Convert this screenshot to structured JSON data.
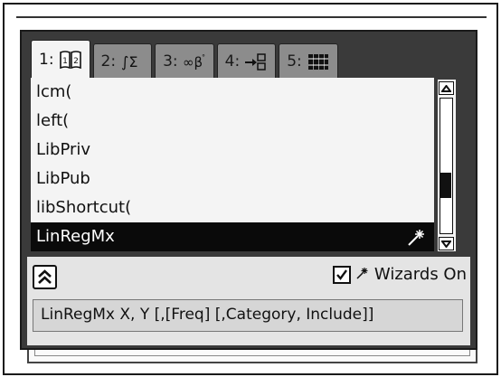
{
  "tabs": [
    {
      "label": "1:",
      "icon": "catalog-book-icon",
      "active": true
    },
    {
      "label": "2:",
      "icon": "math-symbols-icon",
      "active": false
    },
    {
      "label": "3:",
      "icon": "special-chars-icon",
      "active": false
    },
    {
      "label": "4:",
      "icon": "units-icon",
      "active": false
    },
    {
      "label": "5:",
      "icon": "library-icon",
      "active": false
    }
  ],
  "list": {
    "items": [
      "lcm(",
      "left(",
      "LibPriv",
      "LibPub",
      "libShortcut(",
      "LinRegMx"
    ],
    "selected_index": 5
  },
  "wizards": {
    "label": "Wizards On",
    "checked": true
  },
  "syntax": "LinRegMx X, Y [,[Freq] [,Category, Include]]"
}
